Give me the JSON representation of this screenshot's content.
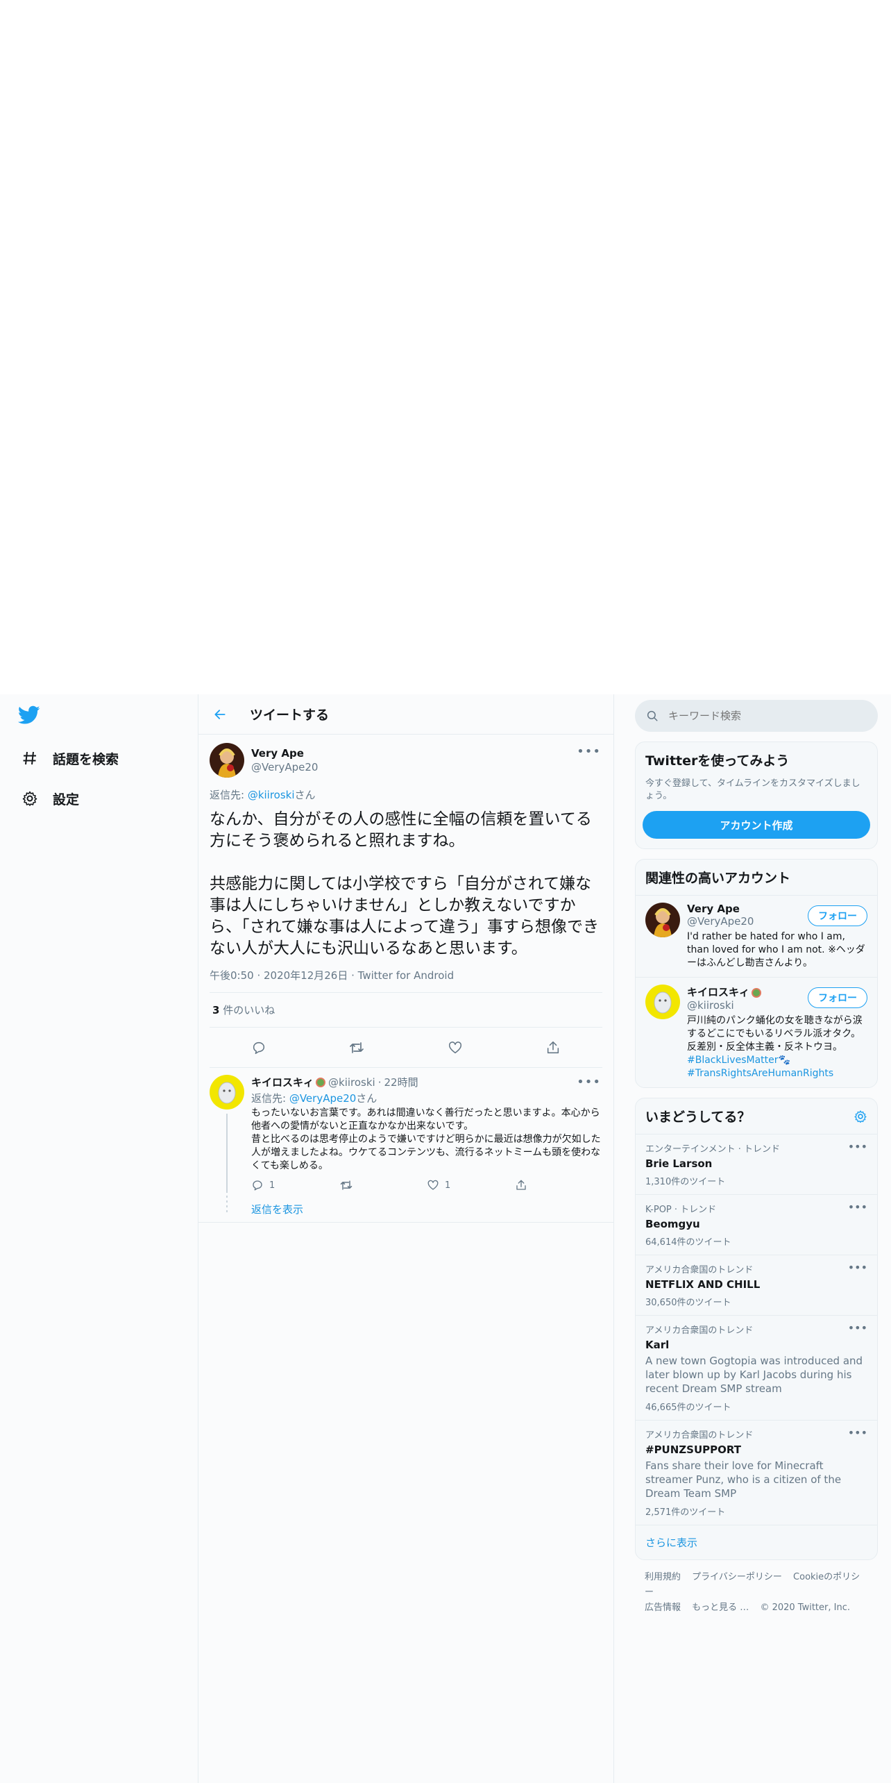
{
  "colors": {
    "accent": "#1da1f2",
    "link": "#1b95e0",
    "muted": "#657786",
    "border": "#e6ecf0"
  },
  "nav": {
    "logo_icon": "twitter-bird-icon",
    "items": [
      {
        "label": "話題を検索",
        "icon": "hashtag-icon"
      },
      {
        "label": "設定",
        "icon": "gear-icon"
      }
    ]
  },
  "header": {
    "title": "ツイートする"
  },
  "tweet": {
    "name": "Very Ape",
    "handle": "@VeryApe20",
    "reply_prefix": "返信先: ",
    "reply_to": "@kiiroski",
    "reply_suffix": "さん",
    "text": "なんか、自分がその人の感性に全幅の信頼を置いてる方にそう褒められると照れますね。\n\n共感能力に関しては小学校ですら「自分がされて嫌な事は人にしちゃいけません」としか教えないですから、「されて嫌な事は人によって違う」事すら想像できない人が大人にも沢山いるなあと思います。",
    "time": "午後0:50",
    "date": "2020年12月26日",
    "source": "Twitter for Android",
    "likes_count": "3",
    "likes_label": " 件のいいね"
  },
  "reply": {
    "name": "キイロスキィ",
    "handle": "@kiiroski",
    "time": "22時間",
    "reply_prefix": "返信先: ",
    "reply_to": "@VeryApe20",
    "reply_suffix": "さん",
    "text": "もったいないお言葉です。あれは間違いなく善行だったと思いますよ。本心から他者への愛情がないと正直なかなか出来ないです。\n昔と比べるのは思考停止のようで嫌いですけど明らかに最近は想像力が欠如した人が増えましたよね。ウケてるコンテンツも、流行るネットミームも頭を使わなくても楽しめる。",
    "reply_count": "1",
    "like_count": "1",
    "show_replies": "返信を表示"
  },
  "search": {
    "placeholder": "キーワード検索"
  },
  "signup": {
    "title": "Twitterを使ってみよう",
    "subtitle": "今すぐ登録して、タイムラインをカスタマイズしましょう。",
    "button": "アカウント作成"
  },
  "related": {
    "title": "関連性の高いアカウント",
    "follow_label": "フォロー",
    "accounts": [
      {
        "name": "Very Ape",
        "handle": "@VeryApe20",
        "bio": "I'd rather be hated for who I am, than loved for who I am not. ※ヘッダーはふんどし勘吉さんより。"
      },
      {
        "name": "キイロスキィ",
        "handle": "@kiiroski",
        "bio": "戸川純のパンク蛹化の女を聴きながら涙するどこにでもいるリベラル派オタク。反差別・反全体主義・反ネトウヨ。",
        "tag1": "#BlackLivesMatter",
        "tag2": "#TransRightsAreHumanRights"
      }
    ]
  },
  "trends": {
    "title": "いまどうしてる？",
    "items": [
      {
        "category": "エンターテインメント · トレンド",
        "name": "Brie Larson",
        "count": "1,310件のツイート"
      },
      {
        "category": "K-POP · トレンド",
        "name": "Beomgyu",
        "count": "64,614件のツイート"
      },
      {
        "category": "アメリカ合衆国のトレンド",
        "name": "NETFLIX AND CHILL",
        "count": "30,650件のツイート"
      },
      {
        "category": "アメリカ合衆国のトレンド",
        "name": "Karl",
        "desc": "A new town Gogtopia was introduced and later blown up by Karl Jacobs during his recent Dream SMP stream",
        "count": "46,665件のツイート"
      },
      {
        "category": "アメリカ合衆国のトレンド",
        "name": "#PUNZSUPPORT",
        "desc": "Fans share their love for Minecraft streamer Punz, who is a citizen of the Dream Team SMP",
        "count": "2,571件のツイート"
      }
    ],
    "show_more": "さらに表示"
  },
  "footer": {
    "links": [
      "利用規約",
      "プライバシーポリシー",
      "Cookieのポリシー",
      "広告情報",
      "もっと見る …"
    ],
    "copyright": "© 2020 Twitter, Inc."
  }
}
